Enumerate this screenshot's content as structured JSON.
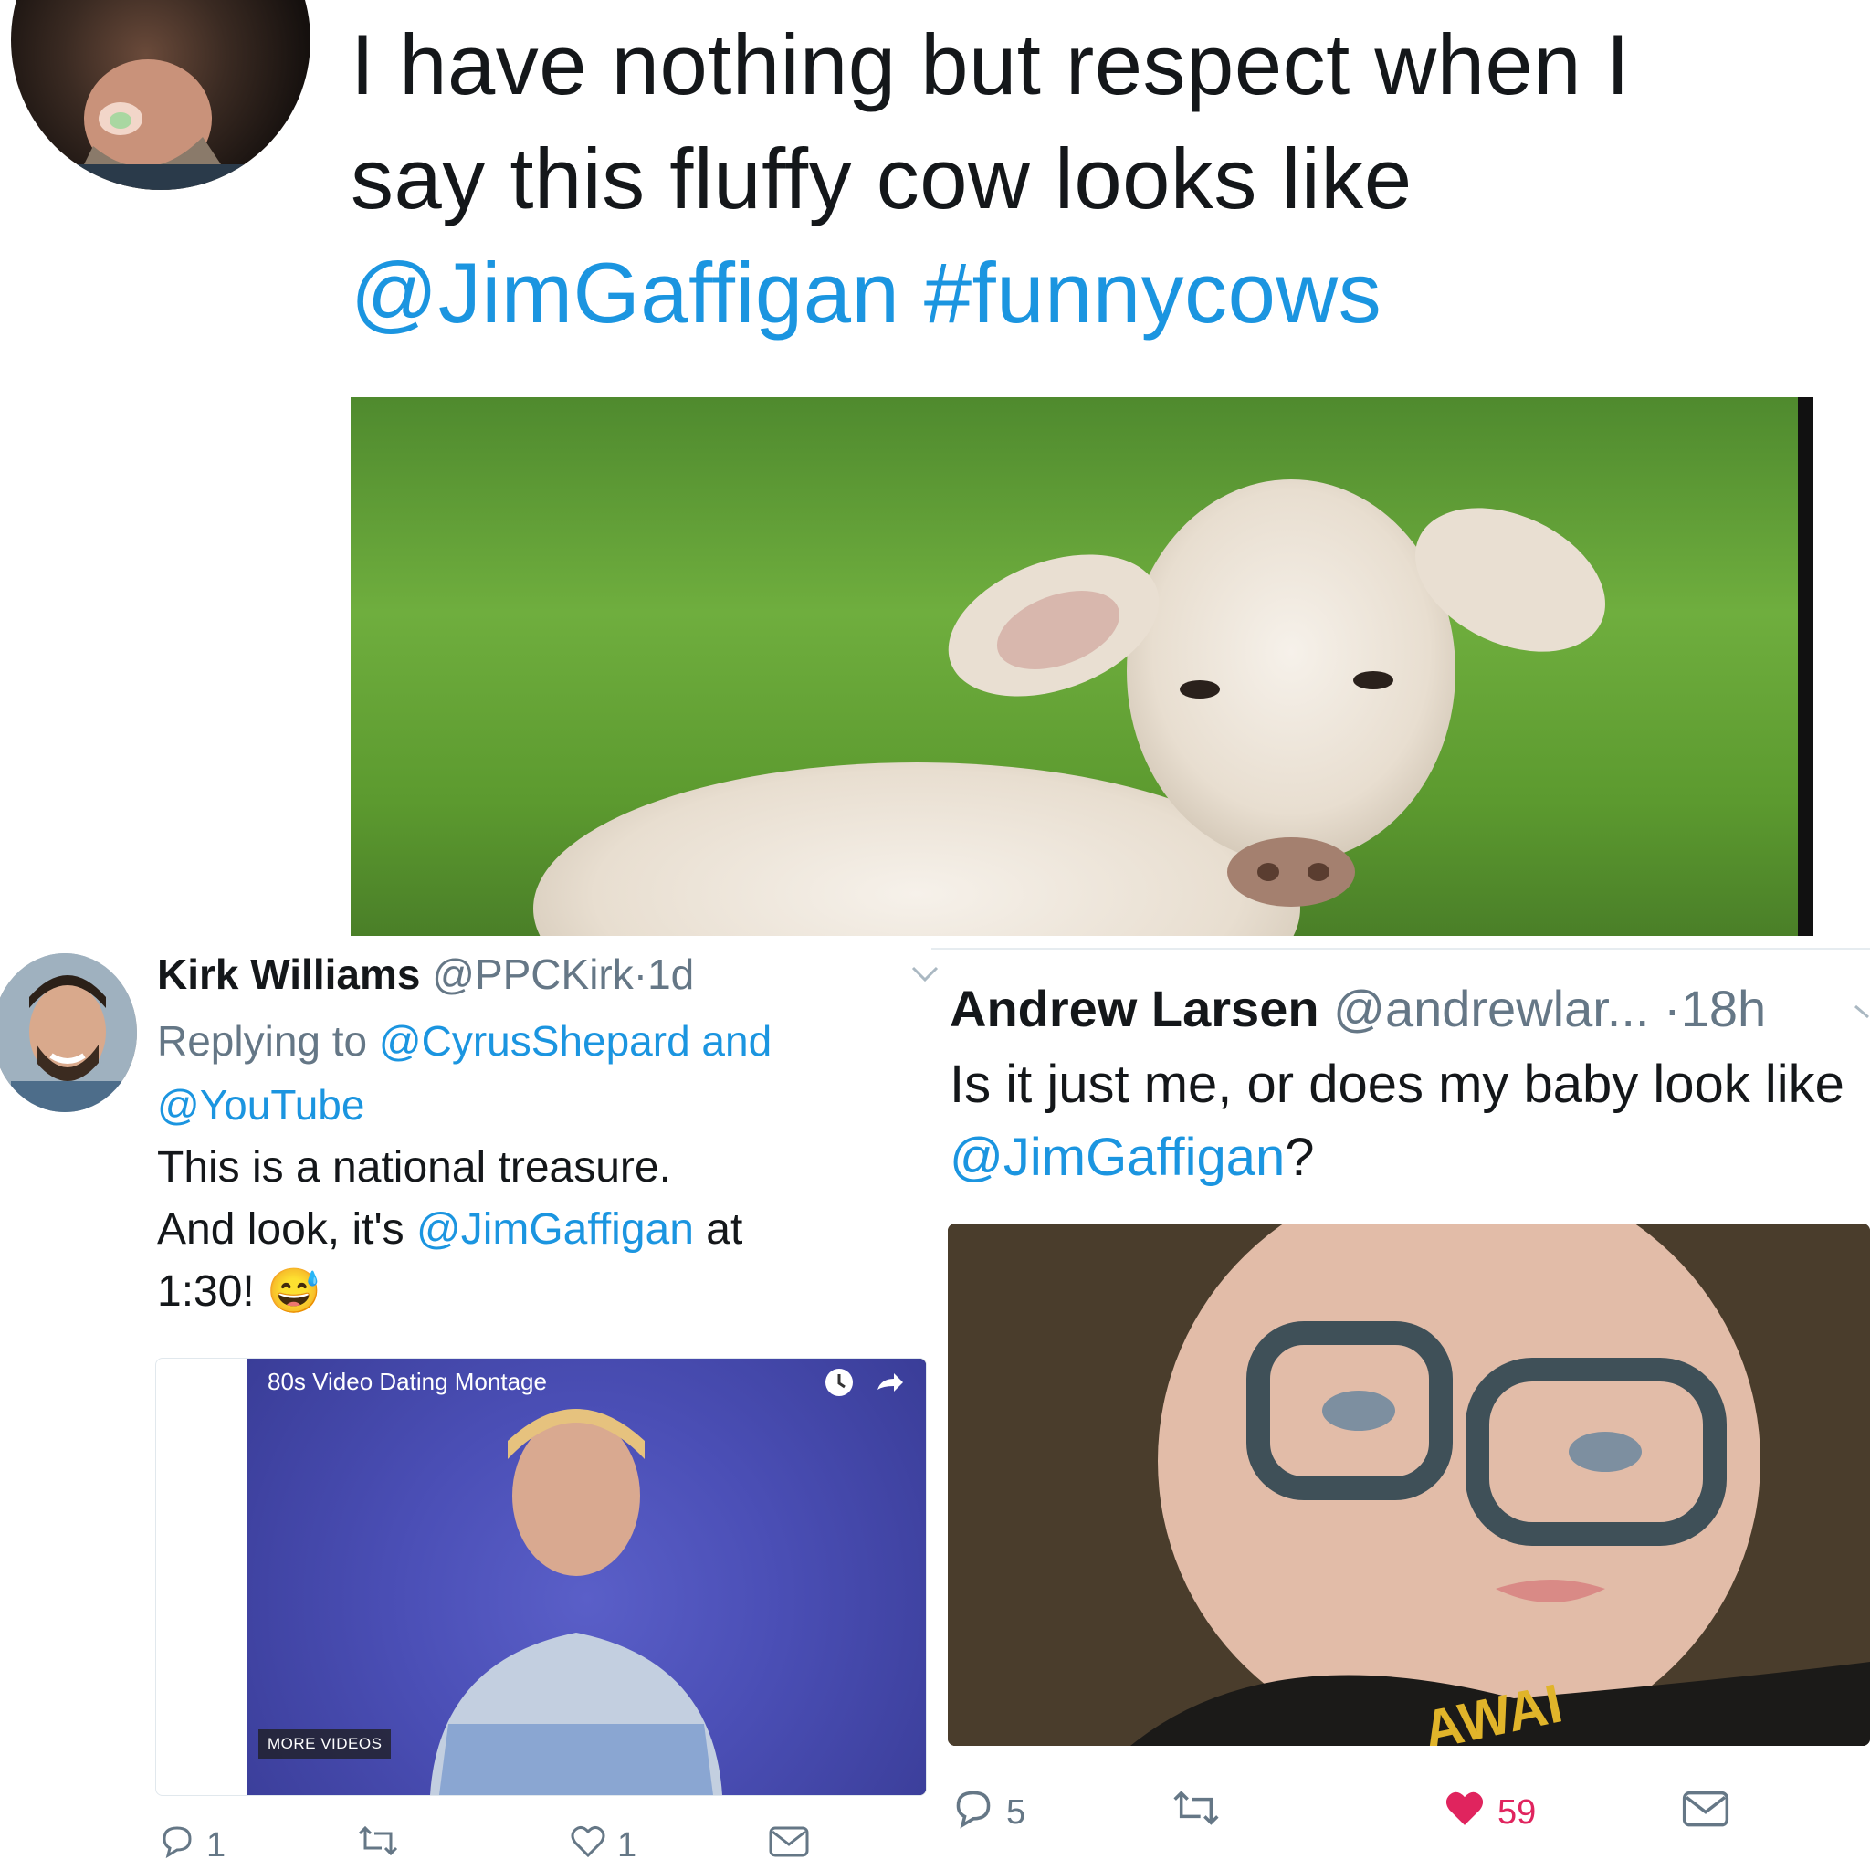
{
  "top_tweet": {
    "text_before": "I have nothing but respect when I say this fluffy cow looks like ",
    "mention": "@JimGaffigan",
    "hashtag": "#funnycows"
  },
  "kirk_tweet": {
    "name": "Kirk Williams",
    "handle": "@PPCKirk",
    "separator": "·",
    "time": "1d",
    "replying_prefix": "Replying to ",
    "replying_to_1": "@CyrusShepard",
    "replying_and": " and ",
    "replying_to_2": "@YouTube",
    "body_line1": "This is a national treasure.",
    "body_line2_prefix": "And look, it's ",
    "body_mention": "@JimGaffigan",
    "body_line2_suffix": " at",
    "body_line3": "1:30!",
    "emoji": "😅",
    "video": {
      "title": "80s Video Dating Montage",
      "more_videos": "MORE VIDEOS"
    },
    "actions": {
      "replies": "1",
      "retweets": "",
      "likes": "1"
    }
  },
  "andrew_tweet": {
    "name": "Andrew Larsen",
    "handle": "@andrewlar...",
    "separator": "·",
    "time": "18h",
    "body_prefix": "Is it just me, or does my baby look like ",
    "body_mention": "@JimGaffigan",
    "body_suffix": "?",
    "actions": {
      "replies": "5",
      "retweets": "",
      "likes": "59"
    }
  },
  "colors": {
    "link": "#1b95e0",
    "muted": "#657786",
    "like_active": "#e0245e"
  },
  "icons": [
    "reply-icon",
    "retweet-icon",
    "heart-icon",
    "dm-icon",
    "chevron-down-icon",
    "clock-icon",
    "share-icon"
  ]
}
